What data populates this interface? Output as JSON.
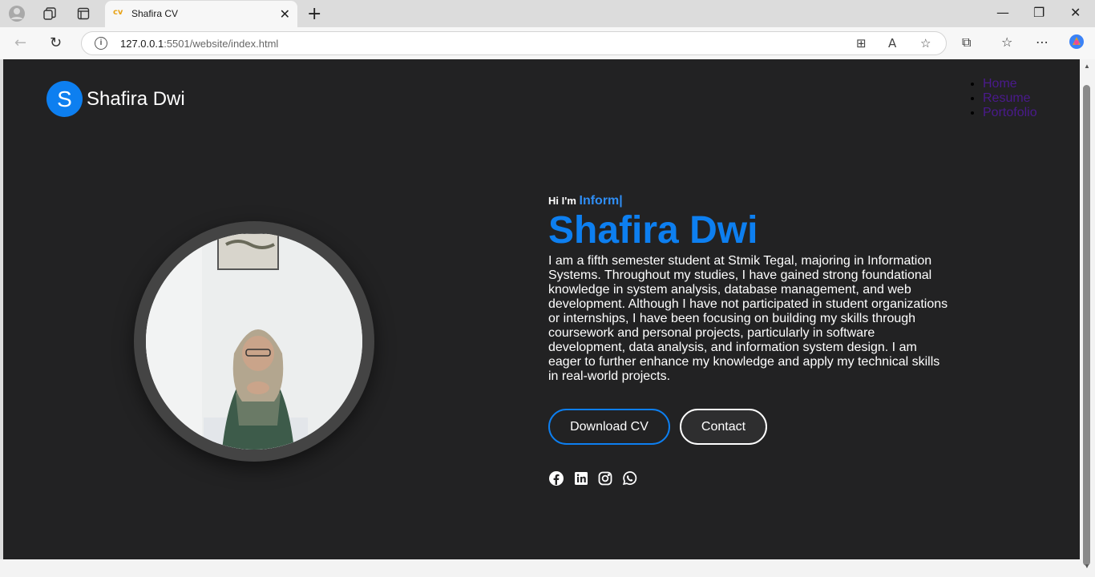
{
  "browser": {
    "tab_title": "Shafira CV",
    "tab_favicon": "cv",
    "url_host": "127.0.0.1",
    "url_rest": ":5501/website/index.html"
  },
  "site": {
    "logo_letter": "S",
    "logo_text": "Shafira Dwi",
    "menu": [
      "Home",
      "Resume",
      "Portofolio"
    ]
  },
  "hero": {
    "greeting": "Hi I'm ",
    "role_typed": "Inform|",
    "name": "Shafira Dwi",
    "bio": "I am a fifth semester student at Stmik Tegal, majoring in Information Systems. Throughout my studies, I have gained strong foundational knowledge in system analysis, database management, and web development. Although I have not participated in student organizations or internships, I have been focusing on building my skills through coursework and personal projects, particularly in software development, data analysis, and information system design. I am eager to further enhance my knowledge and apply my technical skills in real-world projects.",
    "download_label": "Download CV",
    "contact_label": "Contact",
    "socials": [
      "facebook-icon",
      "linkedin-icon",
      "instagram-icon",
      "whatsapp-icon"
    ]
  },
  "colors": {
    "accent": "#0d7ff0",
    "page_bg": "#222223",
    "link": "#4a1a8c"
  }
}
